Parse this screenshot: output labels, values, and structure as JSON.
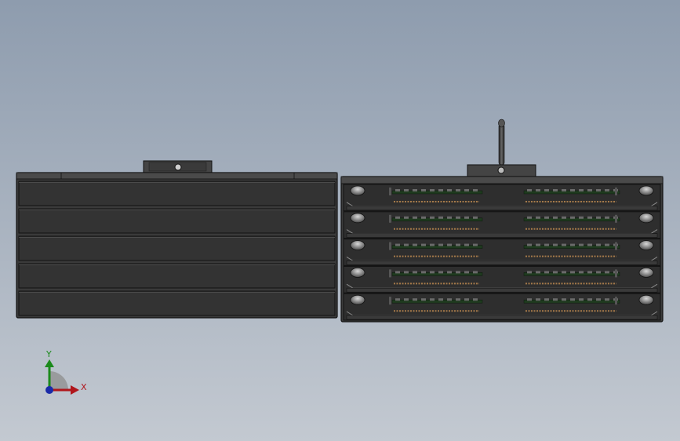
{
  "viewport": {
    "background_top": "#8e9cae",
    "background_bottom": "#c3c9d1"
  },
  "model": {
    "body_color": "#3a3a3a",
    "edge_color": "#111111",
    "panel_color": "#333333",
    "pcb_color": "#1f3a1f",
    "pin_color": "#a57a4a",
    "screw_color": "#9a9a9a"
  },
  "left_unit": {
    "drawer_count": 5
  },
  "right_unit": {
    "tray_count": 5
  },
  "triad": {
    "x_label": "X",
    "y_label": "Y",
    "x_color": "#b0161c",
    "y_color": "#1b8a1b",
    "z_color": "#1a2aa8"
  }
}
